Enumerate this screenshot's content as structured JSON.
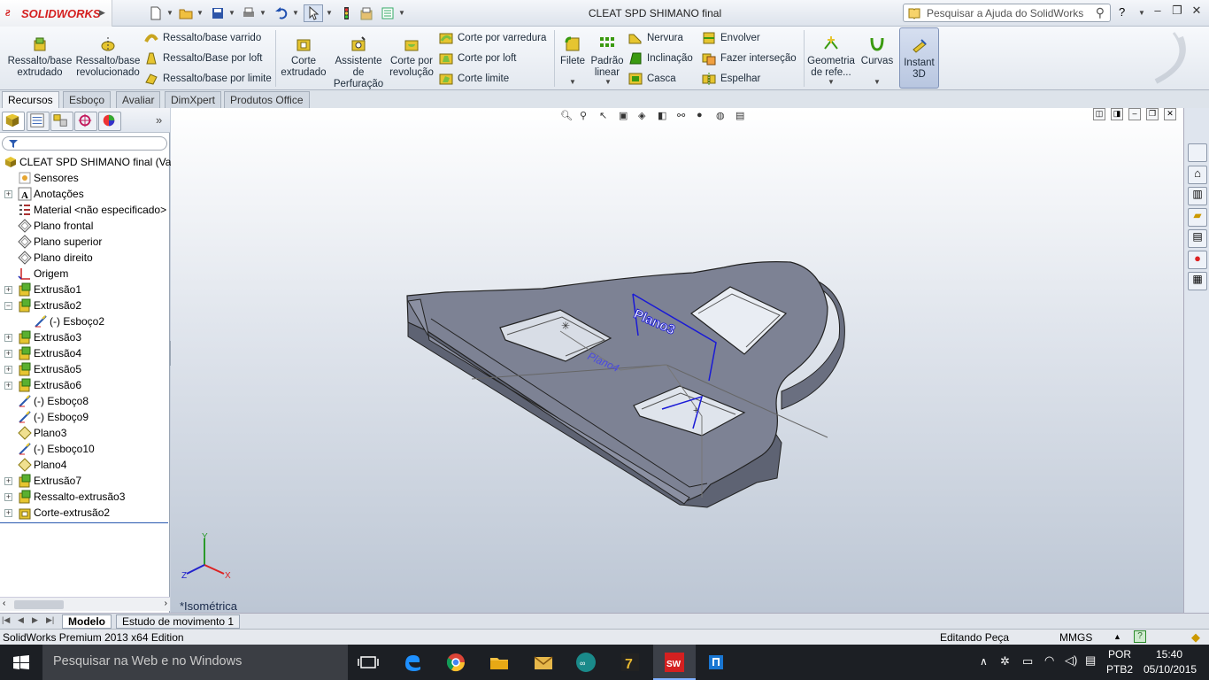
{
  "app": {
    "brand": "SOLIDWORKS",
    "window_title": "CLEAT SPD SHIMANO final"
  },
  "help": {
    "placeholder": "Pesquisar a Ajuda do SolidWorks",
    "help_label": "?"
  },
  "ribbon": {
    "ressalto_extrudado": [
      "Ressalto/base",
      "extrudado"
    ],
    "ressalto_revolucionado": [
      "Ressalto/base",
      "revolucionado"
    ],
    "ressalto_varrido": "Ressalto/base varrido",
    "ressalto_loft": "Ressalto/Base por loft",
    "ressalto_limite": "Ressalto/base por limite",
    "corte_extrudado": [
      "Corte",
      "extrudado"
    ],
    "assistente": [
      "Assistente",
      "de",
      "Perfuração"
    ],
    "corte_revolucao": [
      "Corte por",
      "revolução"
    ],
    "corte_varredura": "Corte por varredura",
    "corte_loft": "Corte por loft",
    "corte_limite": "Corte limite",
    "filete": "Filete",
    "padrao_linear": [
      "Padrão",
      "linear"
    ],
    "nervura": "Nervura",
    "inclinacao": "Inclinação",
    "casca": "Casca",
    "envolver": "Envolver",
    "fazer_intersecao": "Fazer interseção",
    "espelhar": "Espelhar",
    "geometria_ref": [
      "Geometria",
      "de refe..."
    ],
    "curvas": "Curvas",
    "instant3d": [
      "Instant",
      "3D"
    ]
  },
  "cm_tabs": [
    "Recursos",
    "Esboço",
    "Avaliar",
    "DimXpert",
    "Produtos Office"
  ],
  "tree": [
    {
      "label": "CLEAT SPD SHIMANO final  (Va",
      "icon": "part-icon",
      "level": 0,
      "expander": ""
    },
    {
      "label": "Sensores",
      "icon": "sensors-icon",
      "level": 1,
      "expander": ""
    },
    {
      "label": "Anotações",
      "icon": "annotations-icon",
      "level": 1,
      "expander": "+"
    },
    {
      "label": "Material <não especificado>",
      "icon": "material-icon",
      "level": 1,
      "expander": ""
    },
    {
      "label": "Plano frontal",
      "icon": "plane-icon",
      "level": 1,
      "expander": ""
    },
    {
      "label": "Plano superior",
      "icon": "plane-icon",
      "level": 1,
      "expander": ""
    },
    {
      "label": "Plano direito",
      "icon": "plane-icon",
      "level": 1,
      "expander": ""
    },
    {
      "label": "Origem",
      "icon": "origin-icon",
      "level": 1,
      "expander": ""
    },
    {
      "label": "Extrusão1",
      "icon": "extrude-icon",
      "level": 1,
      "expander": "+"
    },
    {
      "label": "Extrusão2",
      "icon": "extrude-icon",
      "level": 1,
      "expander": "−"
    },
    {
      "label": "(-) Esboço2",
      "icon": "sketch-icon",
      "level": 2,
      "expander": ""
    },
    {
      "label": "Extrusão3",
      "icon": "extrude-icon",
      "level": 1,
      "expander": "+"
    },
    {
      "label": "Extrusão4",
      "icon": "extrude-icon",
      "level": 1,
      "expander": "+"
    },
    {
      "label": "Extrusão5",
      "icon": "extrude-icon",
      "level": 1,
      "expander": "+"
    },
    {
      "label": "Extrusão6",
      "icon": "extrude-icon",
      "level": 1,
      "expander": "+"
    },
    {
      "label": "(-) Esboço8",
      "icon": "sketch-icon",
      "level": 1,
      "expander": ""
    },
    {
      "label": "(-) Esboço9",
      "icon": "sketch-icon",
      "level": 1,
      "expander": ""
    },
    {
      "label": "Plano3",
      "icon": "plane-yellow-icon",
      "level": 1,
      "expander": ""
    },
    {
      "label": "(-) Esboço10",
      "icon": "sketch-icon",
      "level": 1,
      "expander": ""
    },
    {
      "label": "Plano4",
      "icon": "plane-yellow-icon",
      "level": 1,
      "expander": ""
    },
    {
      "label": "Extrusão7",
      "icon": "extrude-icon",
      "level": 1,
      "expander": "+"
    },
    {
      "label": "Ressalto-extrusão3",
      "icon": "extrude-icon",
      "level": 1,
      "expander": "+"
    },
    {
      "label": "Corte-extrusão2",
      "icon": "cut-icon",
      "level": 1,
      "expander": "+"
    }
  ],
  "viewport": {
    "view_name": "*Isométrica",
    "plane3_label": "Plano3",
    "plane4_label": "Plano4",
    "axis_x": "X",
    "axis_y": "Y",
    "axis_z": "Z"
  },
  "bottom_tabs": [
    "Modelo",
    "Estudo de movimento 1"
  ],
  "status": {
    "edition": "SolidWorks Premium 2013 x64 Edition",
    "mode": "Editando Peça",
    "units": "MMGS"
  },
  "taskbar": {
    "search_placeholder": "Pesquisar na Web e no Windows",
    "lang1": "POR",
    "lang2": "PTB2",
    "time": "15:40",
    "date": "05/10/2015"
  },
  "colors": {
    "accent": "#d41f1f",
    "model_fill": "#7d8294",
    "plane_blue": "#1a1ad6",
    "taskbar": "#1c1f24"
  }
}
